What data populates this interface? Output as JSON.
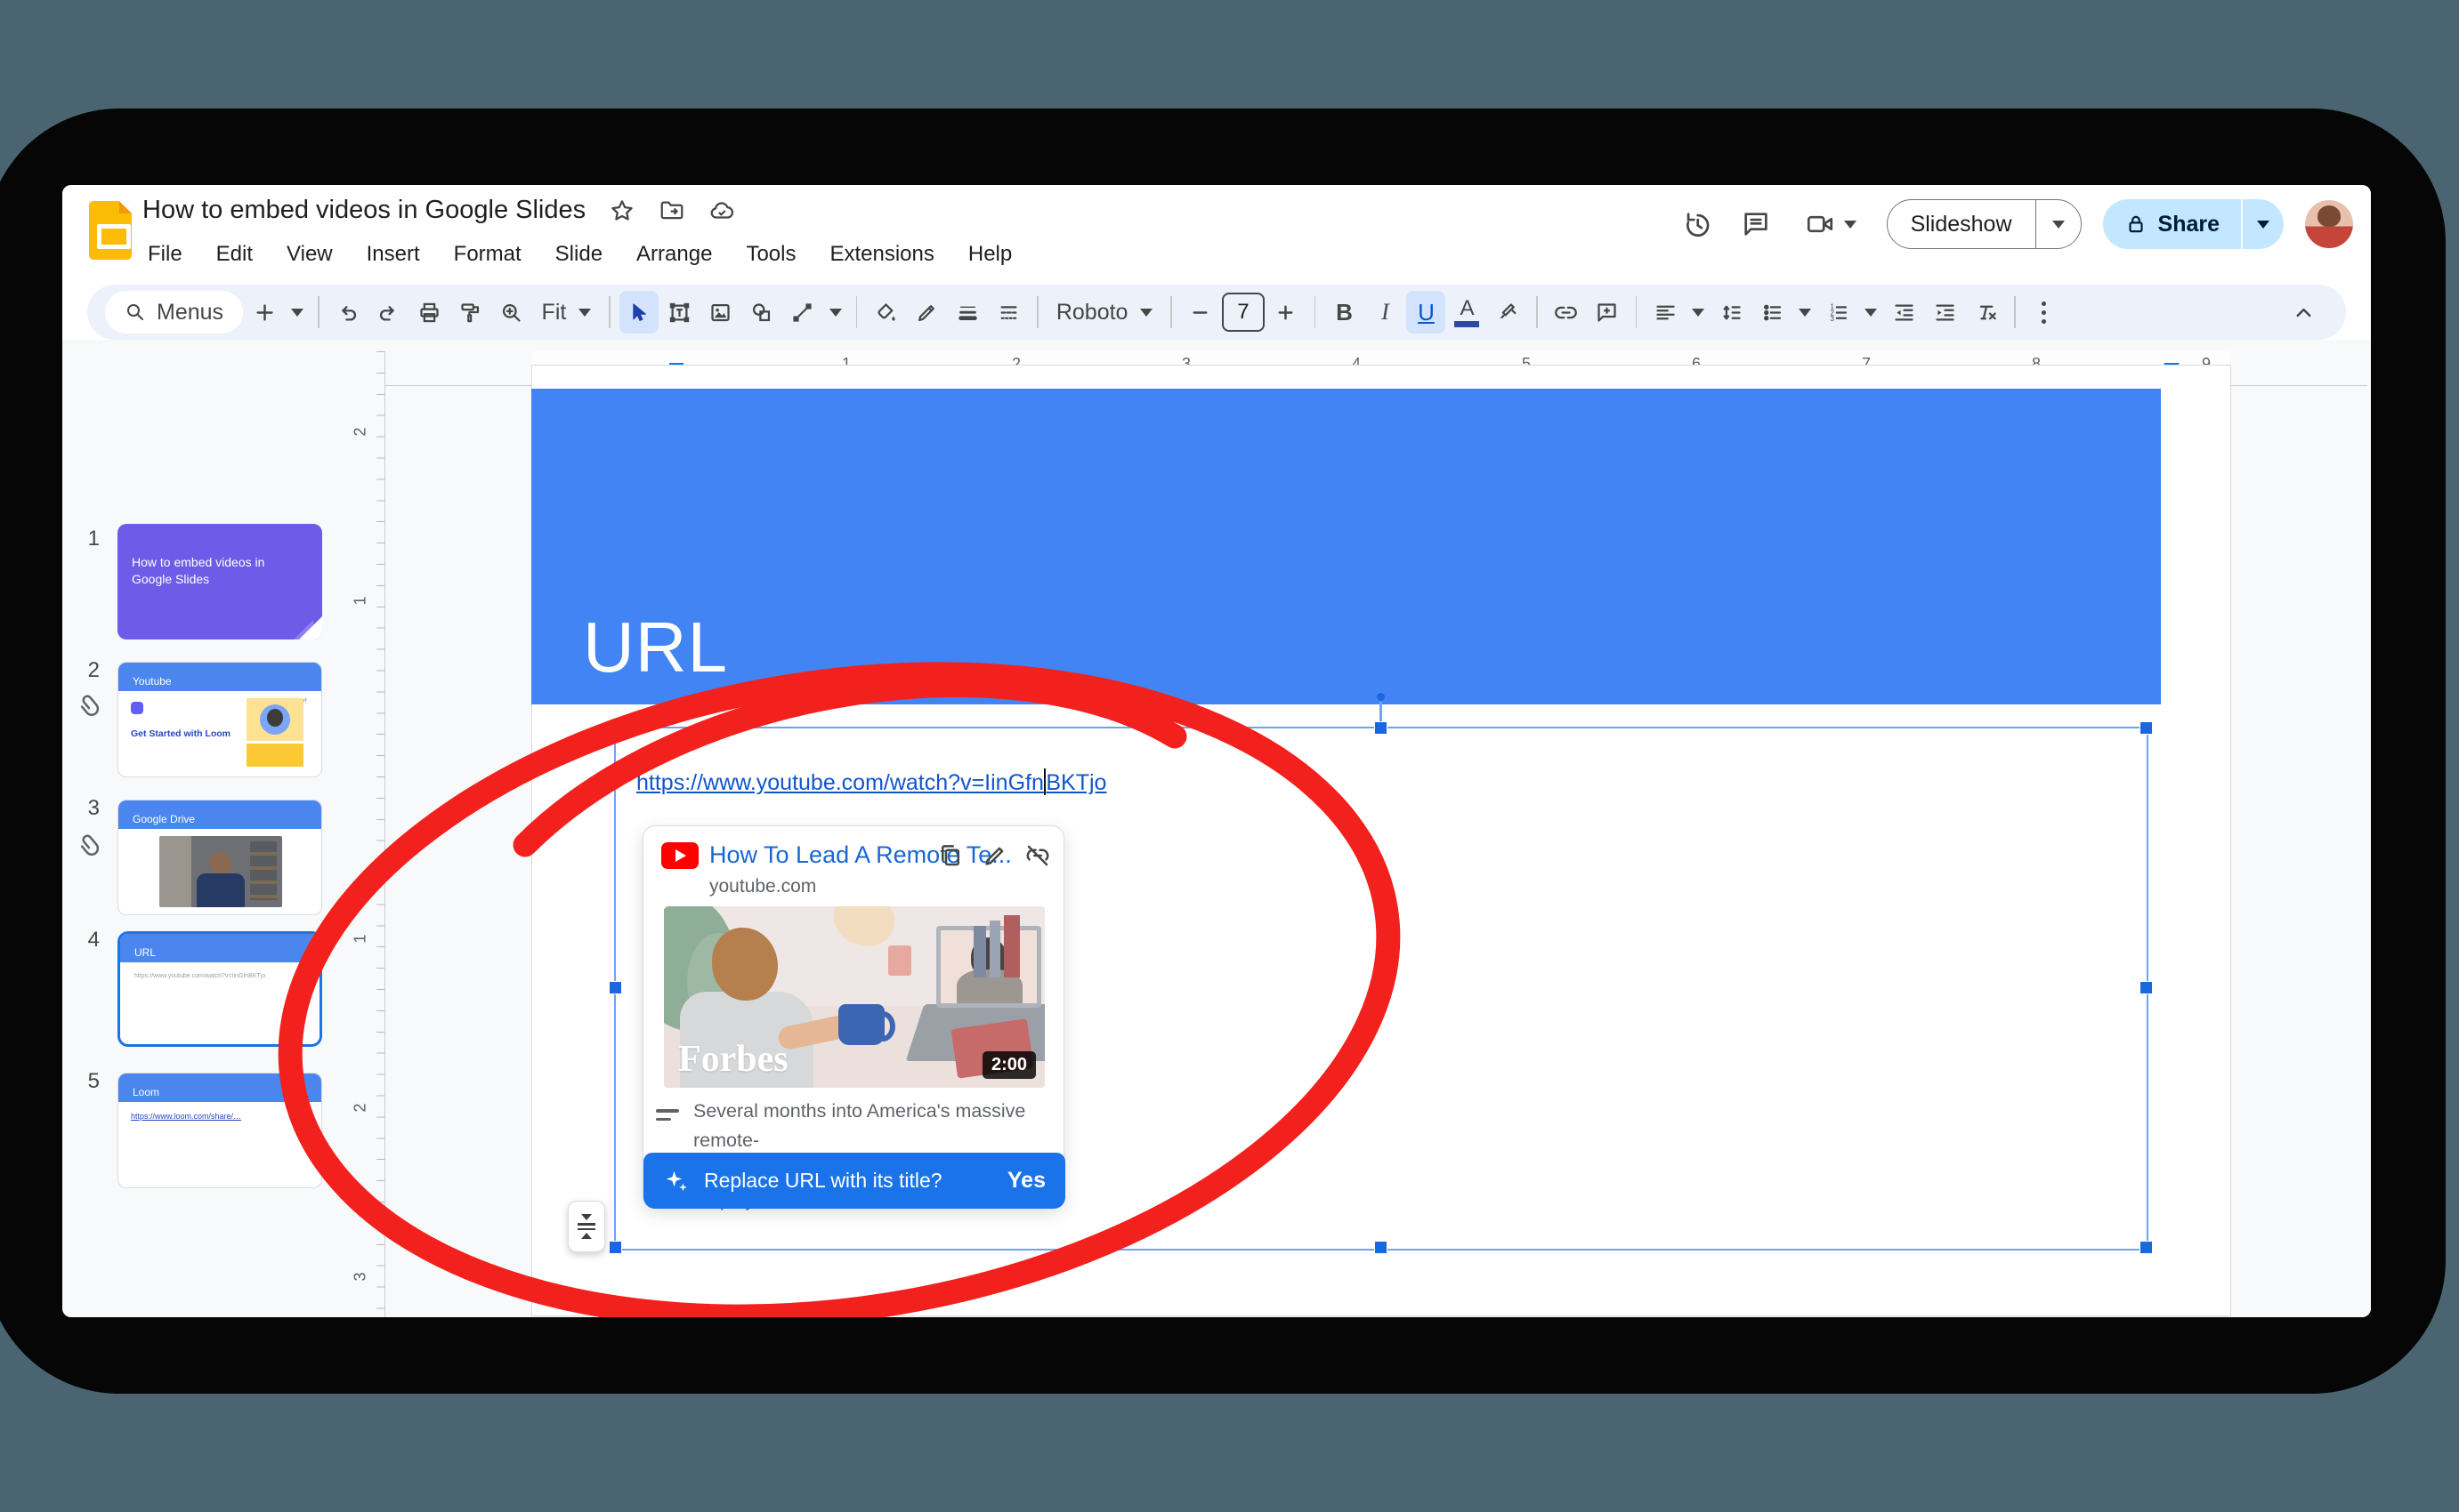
{
  "header": {
    "title": "How to embed videos in Google Slides",
    "menu_items": [
      "File",
      "Edit",
      "View",
      "Insert",
      "Format",
      "Slide",
      "Arrange",
      "Tools",
      "Extensions",
      "Help"
    ],
    "slideshow_label": "Slideshow",
    "share_label": "Share"
  },
  "toolbar": {
    "menus_label": "Menus",
    "zoom_value": "Fit",
    "font_family": "Roboto",
    "font_size": "7"
  },
  "filmstrip": {
    "slides": [
      {
        "number": "1",
        "title": "How to embed videos in Google Slides"
      },
      {
        "number": "2",
        "title": "Youtube",
        "note": "Yay!",
        "card_title": "Get Started with Loom"
      },
      {
        "number": "3",
        "title": "Google Drive"
      },
      {
        "number": "4",
        "title": "URL",
        "body_line": "https://www.youtube.com/watch?v=IinGfnBKTjo"
      },
      {
        "number": "5",
        "title": "Loom",
        "body_line": "https://www.loom.com/share/…"
      }
    ]
  },
  "rulers": {
    "horizontal": [
      "1",
      "2",
      "3",
      "4",
      "5",
      "6",
      "7",
      "8",
      "9"
    ],
    "vertical": [
      "2",
      "1",
      "1",
      "2",
      "3"
    ]
  },
  "slide": {
    "title": "URL",
    "url_before_caret": "https://www.youtube.com/watch?v=IinGfn",
    "url_after_caret": "BKTjo"
  },
  "link_card": {
    "title": "How To Lead A Remote Te...",
    "domain": "youtube.com",
    "brand": "Forbes",
    "duration": "2:00",
    "description_line1": "Several months into America's massive remote-",
    "description_line2": "work experiment, managers and employees are s..."
  },
  "replace_bar": {
    "question": "Replace URL with its title?",
    "yes_label": "Yes"
  },
  "colors": {
    "accent_blue": "#1a73e8",
    "slide_header_blue": "#4284f3",
    "share_bg": "#c2e7ff",
    "annotation_red": "#f3211d",
    "backdrop_teal": "#4a6571"
  }
}
